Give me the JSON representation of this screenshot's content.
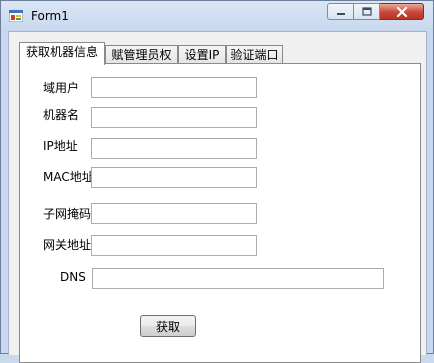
{
  "window": {
    "title": "Form1",
    "app_icon": "winforms-app-icon",
    "controls": {
      "minimize_icon": "minimize-icon",
      "maximize_icon": "maximize-icon",
      "close_icon": "close-icon"
    }
  },
  "tabs": [
    {
      "label": "获取机器信息",
      "active": true
    },
    {
      "label": "赋管理员权",
      "active": false
    },
    {
      "label": "设置IP",
      "active": false
    },
    {
      "label": "验证端口",
      "active": false
    }
  ],
  "form": {
    "domain_user": {
      "label": "域用户",
      "value": ""
    },
    "machine_name": {
      "label": "机器名",
      "value": ""
    },
    "ip_address": {
      "label": "IP地址",
      "value": ""
    },
    "mac_address": {
      "label": "MAC地址",
      "value": ""
    },
    "subnet_mask": {
      "label": "子网掩码",
      "value": ""
    },
    "gateway": {
      "label": "网关地址",
      "value": ""
    },
    "dns": {
      "label": "DNS",
      "value": ""
    }
  },
  "actions": {
    "get_label": "获取"
  },
  "colors": {
    "window_frame": "#c8d8ee",
    "close_button": "#c8473a",
    "panel": "#ffffff"
  }
}
